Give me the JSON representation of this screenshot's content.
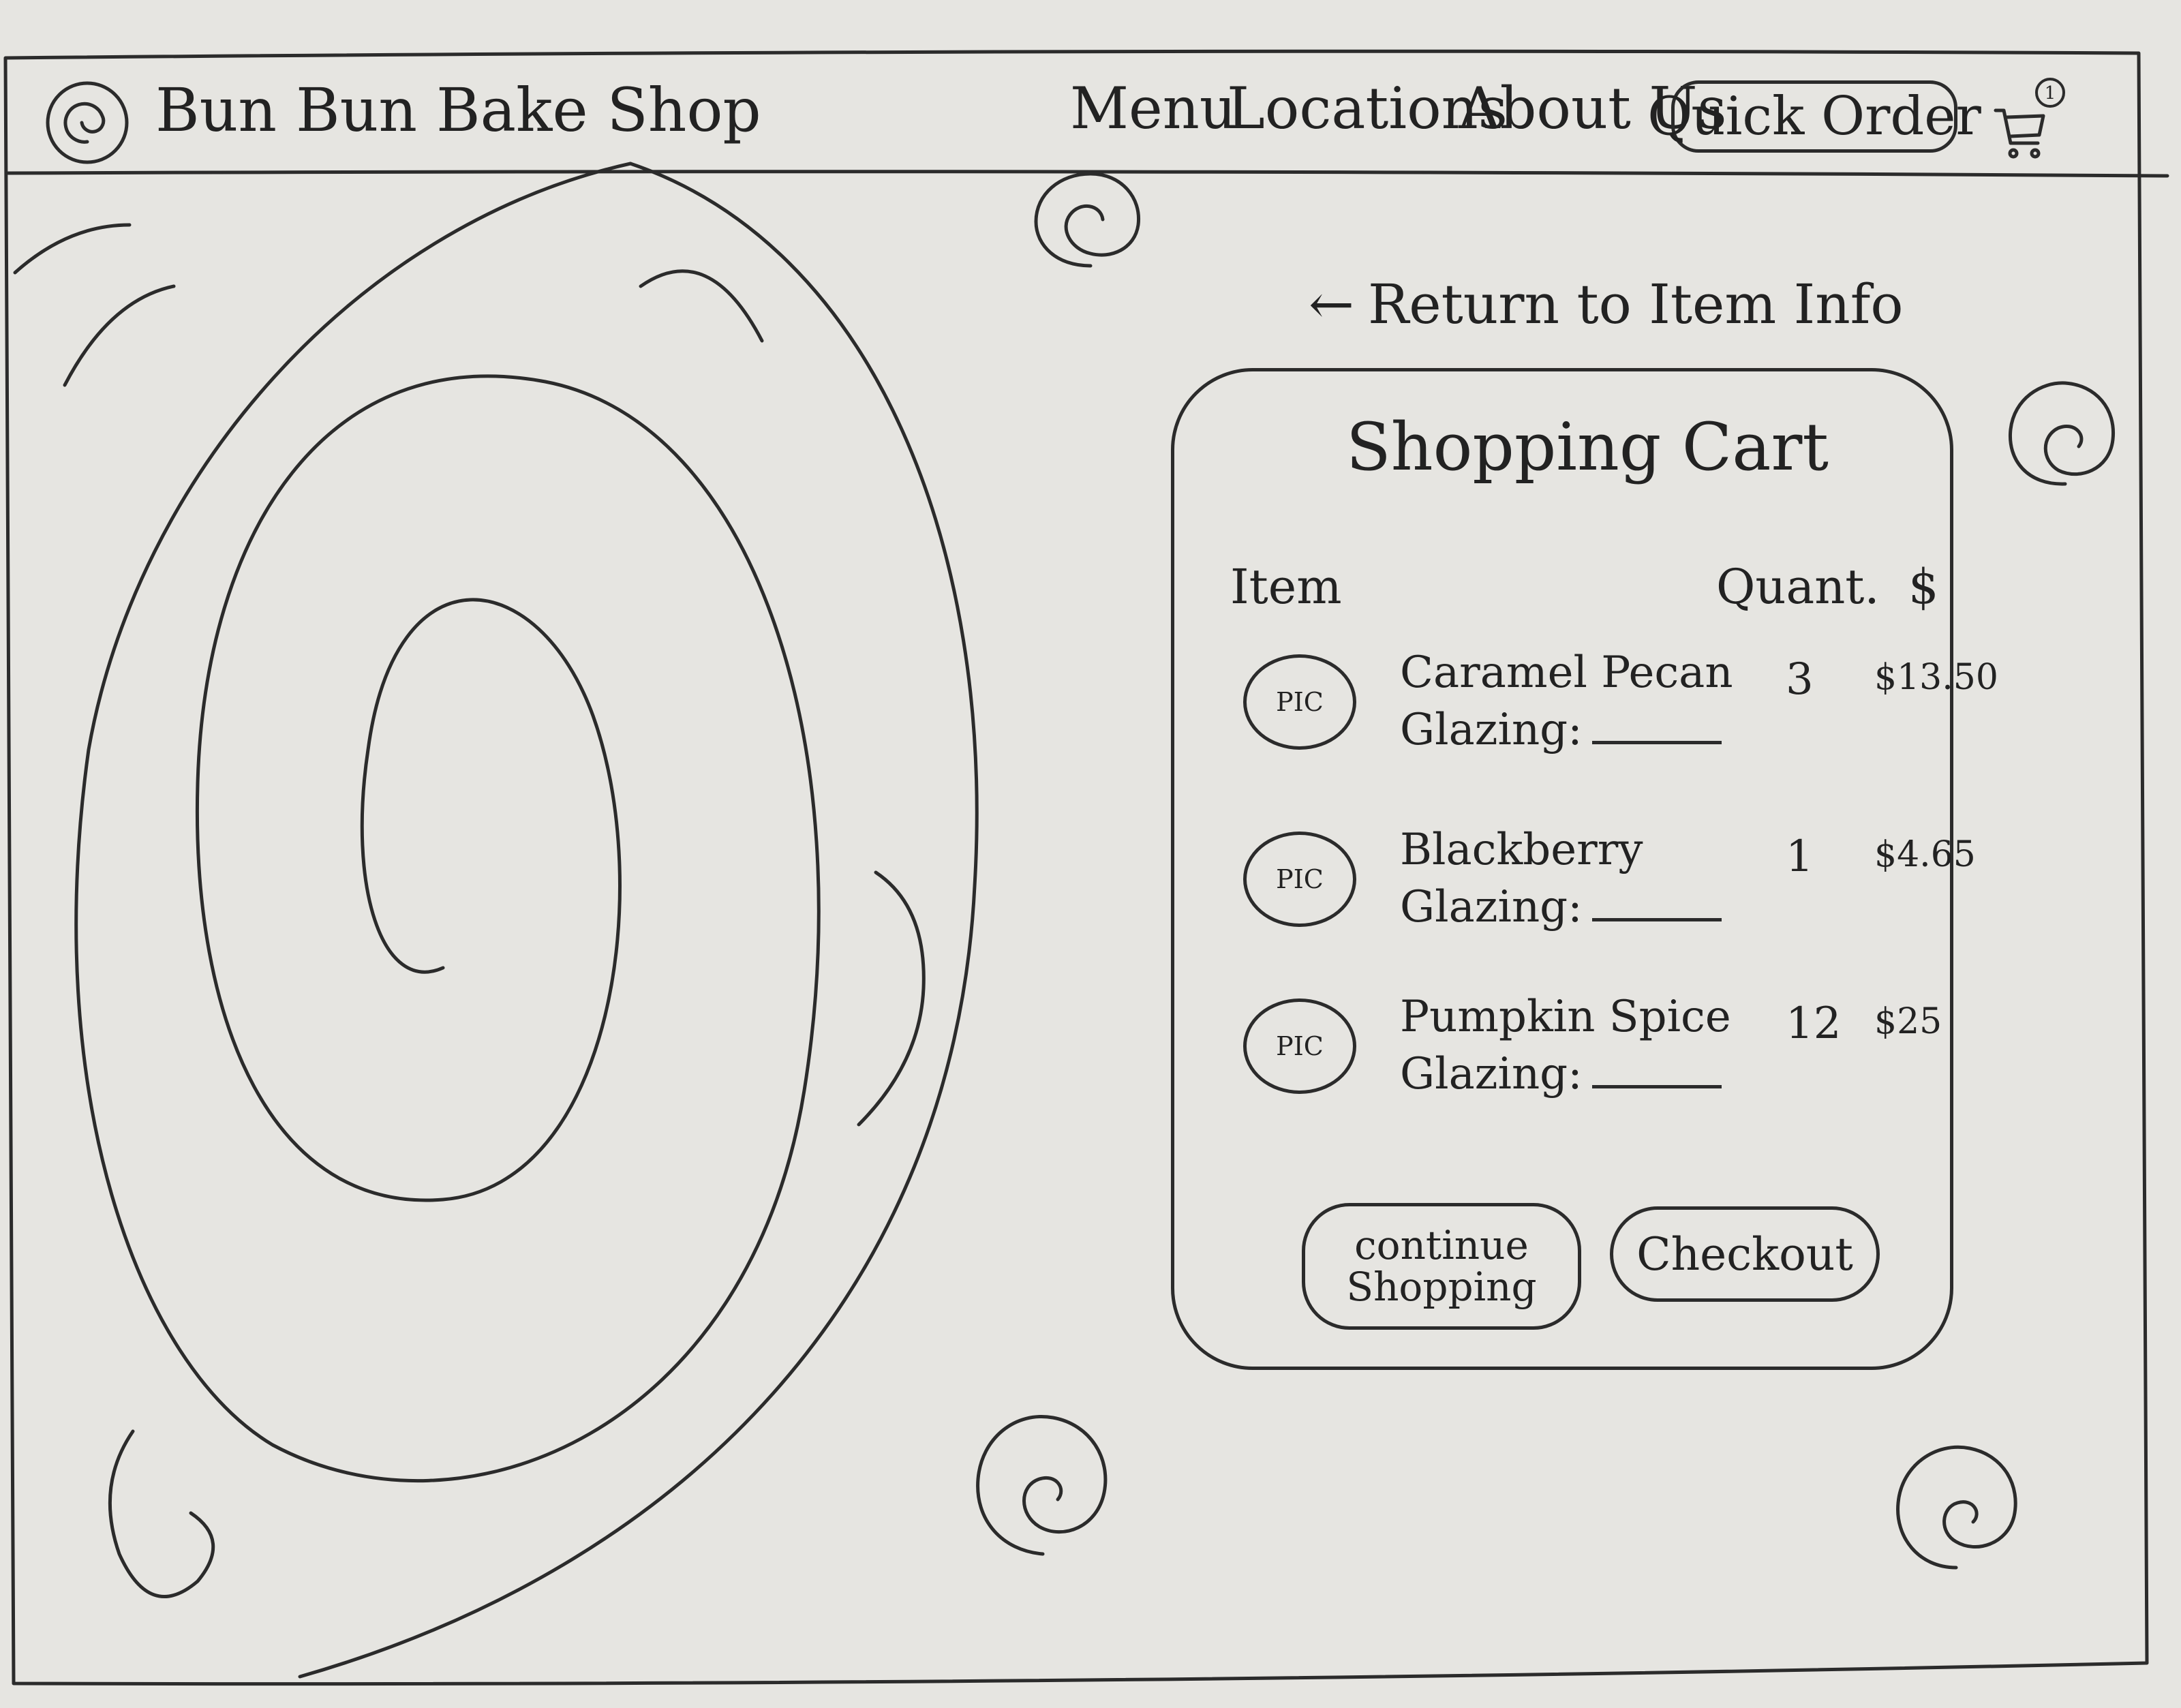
{
  "header": {
    "brand": "Bun Bun Bake Shop",
    "nav": {
      "menu": "Menu",
      "locations": "Locations",
      "about": "About Us",
      "quick_order": "Quick Order"
    },
    "cart_count": "1"
  },
  "return_link": "Return to Item Info",
  "cart": {
    "title": "Shopping Cart",
    "columns": {
      "item": "Item",
      "quantity": "Quant.",
      "price": "$"
    },
    "pic_placeholder": "PIC",
    "glazing_label": "Glazing:",
    "items": [
      {
        "name": "Caramel Pecan",
        "quantity": "3",
        "price": "$13.50"
      },
      {
        "name": "Blackberry",
        "quantity": "1",
        "price": "$4.65"
      },
      {
        "name": "Pumpkin Spice",
        "quantity": "12",
        "price": "$25"
      }
    ],
    "continue_label": "continue Shopping",
    "checkout_label": "Checkout"
  },
  "icons": {
    "logo": "cinnamon-roll-spiral-icon",
    "cart": "shopping-cart-icon",
    "decor": "spiral-icon"
  }
}
